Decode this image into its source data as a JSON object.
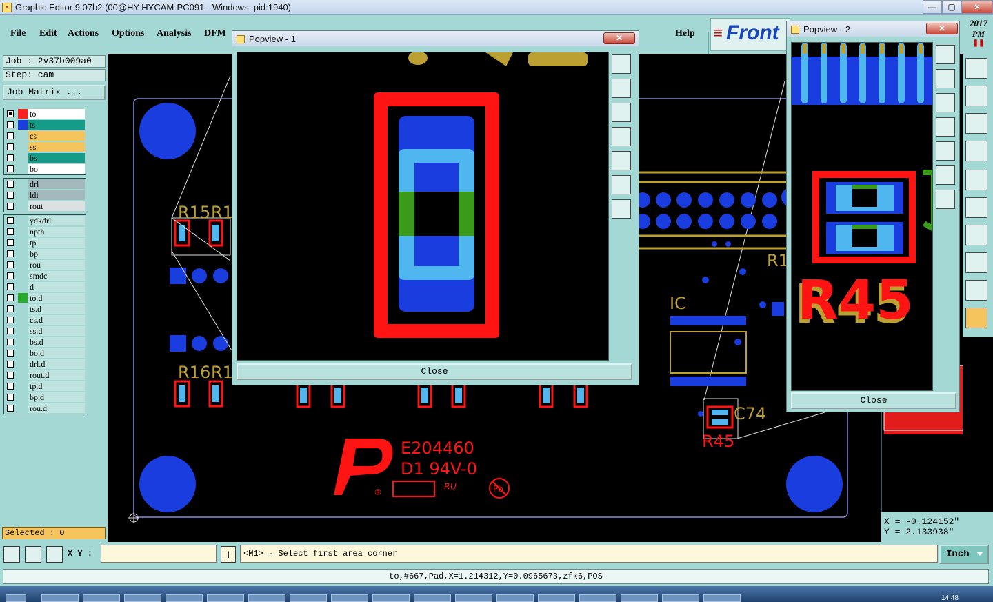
{
  "window": {
    "title": "Graphic Editor 9.07b2 (00@HY-HYCAM-PC091 - Windows, pid:1940)",
    "min": "—",
    "max": "▢",
    "close": "✕"
  },
  "menu": {
    "file": "File",
    "edit": "Edit",
    "actions": "Actions",
    "options": "Options",
    "analysis": "Analysis",
    "dfm": "DFM",
    "help": "Help"
  },
  "logo": {
    "text": "Front",
    "year": "2017",
    "ampm": "PM",
    "pause": "❚❚"
  },
  "job": {
    "job_line": "Job : 2v37b009a0",
    "step_line": "Step: cam",
    "matrix_button": "Job Matrix ..."
  },
  "layers": {
    "group1": [
      {
        "name": "to",
        "color": "#ffffff",
        "swatch": "#ff2020",
        "checked": true
      },
      {
        "name": "ts",
        "color": "#159c88",
        "swatch": "#1a3de0",
        "checked": false
      },
      {
        "name": "cs",
        "color": "#f6c45c",
        "swatch": "",
        "checked": false
      },
      {
        "name": "ss",
        "color": "#f6c45c",
        "swatch": "",
        "checked": false
      },
      {
        "name": "bs",
        "color": "#159c88",
        "swatch": "",
        "checked": false
      },
      {
        "name": "bo",
        "color": "#ffffff",
        "swatch": "",
        "checked": false
      }
    ],
    "group2": [
      {
        "name": "drl",
        "color": "#a4b9bb"
      },
      {
        "name": "ldi",
        "color": "#a4b9bb"
      },
      {
        "name": "rout",
        "color": "#d9e1e2"
      }
    ],
    "group3": [
      {
        "name": "ydkdrl",
        "swatch": ""
      },
      {
        "name": "npth",
        "swatch": ""
      },
      {
        "name": "tp",
        "swatch": ""
      },
      {
        "name": "bp",
        "swatch": ""
      },
      {
        "name": "rou",
        "swatch": ""
      },
      {
        "name": "smdc",
        "swatch": ""
      },
      {
        "name": "d",
        "swatch": ""
      },
      {
        "name": "to.d",
        "swatch": "#2aa82a"
      },
      {
        "name": "ts.d",
        "swatch": ""
      },
      {
        "name": "cs.d",
        "swatch": ""
      },
      {
        "name": "ss.d",
        "swatch": ""
      },
      {
        "name": "bs.d",
        "swatch": ""
      },
      {
        "name": "bo.d",
        "swatch": ""
      },
      {
        "name": "drl.d",
        "swatch": ""
      },
      {
        "name": "rout.d",
        "swatch": ""
      },
      {
        "name": "tp.d",
        "swatch": ""
      },
      {
        "name": "bp.d",
        "swatch": ""
      },
      {
        "name": "rou.d",
        "swatch": ""
      }
    ]
  },
  "selected": "Selected : 0",
  "command": {
    "xy_label": "X Y :",
    "xy_value": "",
    "bang": "!",
    "prompt": "<M1> - Select first area corner",
    "unit": "Inch"
  },
  "status": "to,#667,Pad,X=1.214312,Y=0.0965673,zfk6,POS",
  "coords": {
    "x": "X = -0.124152\"",
    "y": "Y = 2.133938\""
  },
  "clock": "14:48",
  "board": {
    "labels": {
      "r15": "R15",
      "r1a": "R1",
      "r16": "R16",
      "r1b": "R1",
      "ic": "IC",
      "r1c": "R1",
      "c74": "C74",
      "r45": "R45"
    },
    "marking": {
      "code": "E204460",
      "grade": "D1  94V-0",
      "pb": "Pb",
      "ul": "ᴿᵁ",
      "reg": "®"
    }
  },
  "popview1": {
    "title": "Popview - 1",
    "close_label": "Close"
  },
  "popview2": {
    "title": "Popview - 2",
    "close_label": "Close",
    "label": "R45"
  },
  "colors": {
    "teal": "#a3d8d4",
    "pad_blue": "#1a3de0",
    "light_blue": "#4fb6f0",
    "outline_red": "#ff1414",
    "silk_gold": "#bda032",
    "green": "#3a9a1a"
  }
}
